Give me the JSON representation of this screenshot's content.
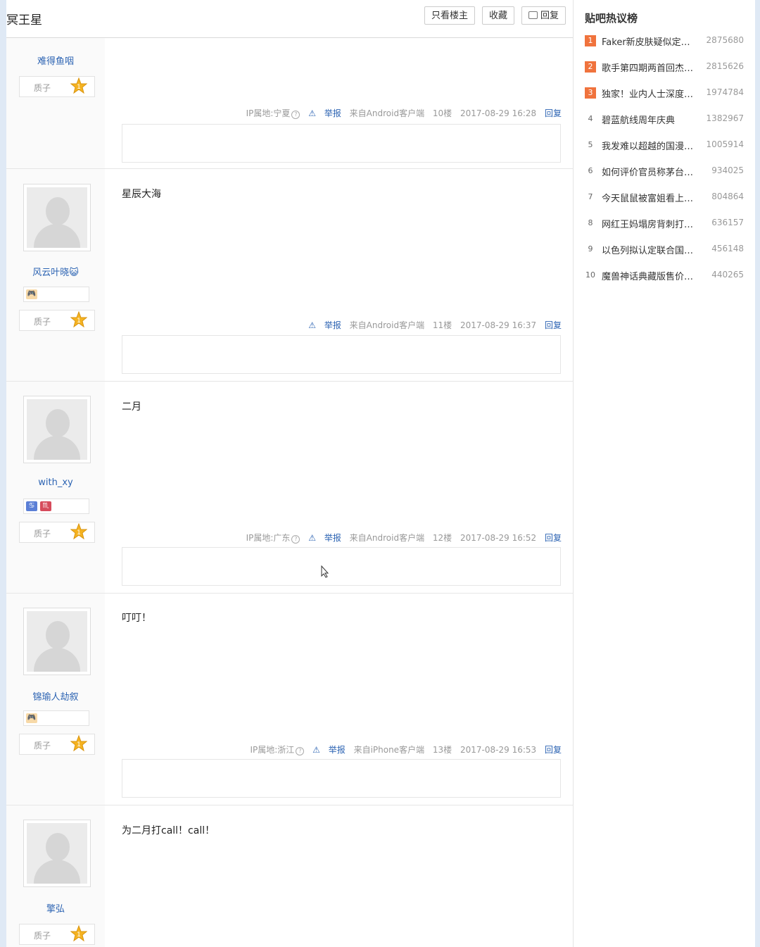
{
  "header": {
    "title": "冥王星",
    "btn_only_op": "只看楼主",
    "btn_collect": "收藏",
    "btn_reply": "回复"
  },
  "posts": [
    {
      "username": "难得鱼咽",
      "level_name": "质子",
      "level_num": "1",
      "content": "",
      "ip": "IP属地:宁夏",
      "report": "举报",
      "source": "来自Android客户端",
      "floor": "10楼",
      "time": "2017-08-29 16:28",
      "reply": "回复"
    },
    {
      "username": "风云叶晓😺",
      "level_name": "质子",
      "level_num": "1",
      "content": "星辰大海",
      "ip": "",
      "report": "举报",
      "source": "来自Android客户端",
      "floor": "11楼",
      "time": "2017-08-29 16:37",
      "reply": "回复"
    },
    {
      "username": "with_xy",
      "level_name": "质子",
      "level_num": "1",
      "content": "二月",
      "ip": "IP属地:广东",
      "report": "举报",
      "source": "来自Android客户端",
      "floor": "12楼",
      "time": "2017-08-29 16:52",
      "reply": "回复"
    },
    {
      "username": "锦瑜人劫叙",
      "level_name": "质子",
      "level_num": "1",
      "content": "叮叮！",
      "ip": "IP属地:浙江",
      "report": "举报",
      "source": "来自iPhone客户端",
      "floor": "13楼",
      "time": "2017-08-29 16:53",
      "reply": "回复"
    },
    {
      "username": "擎弘",
      "level_name": "质子",
      "level_num": "1",
      "content": "为二月打call！call！"
    }
  ],
  "sidebar": {
    "title": "贴吧热议榜",
    "items": [
      {
        "rank": "1",
        "text": "Faker新皮肤疑似定…",
        "count": "2875680"
      },
      {
        "rank": "2",
        "text": "歌手第四期两首回杰…",
        "count": "2815626"
      },
      {
        "rank": "3",
        "text": "独家！业内人士深度…",
        "count": "1974784"
      },
      {
        "rank": "4",
        "text": "碧蓝航线周年庆典",
        "count": "1382967"
      },
      {
        "rank": "5",
        "text": "我发难以超越的国漫…",
        "count": "1005914"
      },
      {
        "rank": "6",
        "text": "如何评价官员称茅台…",
        "count": "934025"
      },
      {
        "rank": "7",
        "text": "今天鼠鼠被富姐看上…",
        "count": "804864"
      },
      {
        "rank": "8",
        "text": "网红王妈塌房背刺打…",
        "count": "636157"
      },
      {
        "rank": "9",
        "text": "以色列拟认定联合国…",
        "count": "456148"
      },
      {
        "rank": "10",
        "text": "魔兽神话典藏版售价…",
        "count": "440265"
      }
    ]
  },
  "colors": {
    "link": "#2d64b3",
    "hot_rank": "#f0733d",
    "level_star": "#f5b321"
  }
}
